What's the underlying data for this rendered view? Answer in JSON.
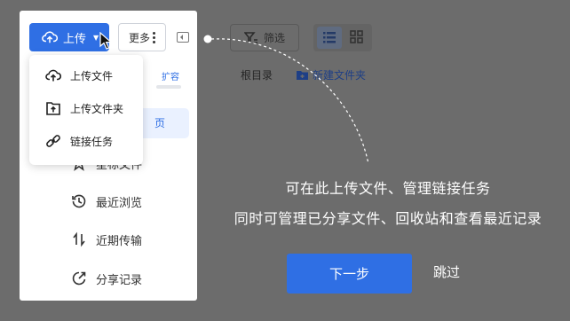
{
  "toolbar": {
    "upload_label": "上传",
    "more_label": "更多",
    "filter_label": "筛选"
  },
  "upload_menu": {
    "items": [
      {
        "label": "上传文件",
        "icon": "cloud-upload-icon"
      },
      {
        "label": "上传文件夹",
        "icon": "folder-upload-icon"
      },
      {
        "label": "链接任务",
        "icon": "link-icon"
      }
    ]
  },
  "storage": {
    "expand_label": "扩容"
  },
  "sidebar": {
    "active_partial": "页",
    "items": [
      {
        "label": "星标文件",
        "icon": "star-icon"
      },
      {
        "label": "最近浏览",
        "icon": "history-icon"
      },
      {
        "label": "近期传输",
        "icon": "transfer-icon"
      },
      {
        "label": "分享记录",
        "icon": "share-icon"
      }
    ]
  },
  "breadcrumb": {
    "root": "根目录",
    "new_folder": "新建文件夹"
  },
  "guide": {
    "line1": "可在此上传文件、管理链接任务",
    "line2": "同时可管理已分享文件、回收站和查看最近记录",
    "next_label": "下一步",
    "skip_label": "跳过"
  },
  "colors": {
    "accent": "#2f6fe4",
    "overlay": "#6c6c6c"
  }
}
